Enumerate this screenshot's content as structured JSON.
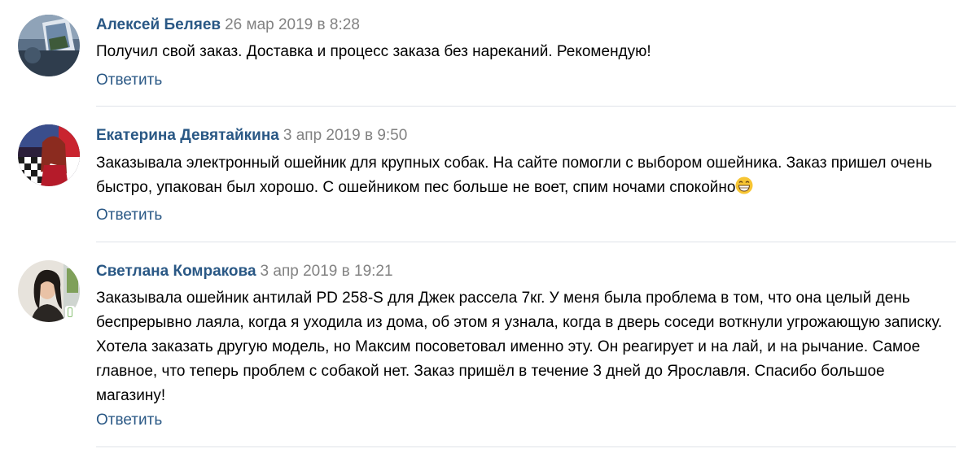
{
  "comments": [
    {
      "author": "Алексей Беляев",
      "date": "26 мар 2019 в 8:28",
      "text": "Получил свой заказ. Доставка и процесс заказа без нареканий. Рекомендую!",
      "reply_label": "Ответить",
      "avatar": "photo-avatar"
    },
    {
      "author": "Екатерина Девятайкина",
      "date": "3 апр 2019 в 9:50",
      "text": "Заказывала электронный ошейник для крупных собак. На сайте помогли с выбором ошейника. Заказ пришел очень быстро, упакован был хорошо. С ошейником пес больше не воет, спим ночами спокойно",
      "emoji": "grinning-face-emoji",
      "reply_label": "Ответить",
      "avatar": "photo-avatar"
    },
    {
      "author": "Светлана Комракова",
      "date": "3 апр 2019 в 19:21",
      "text": "Заказывала ошейник антилай PD 258-S для Джек рассела 7кг. У меня была проблема в том, что она целый день беспрерывно лаяла, когда я уходила из дома, об этом я узнала, когда в дверь соседи воткнули угрожающую записку. Хотела заказать другую модель, но Максим посоветовал именно эту. Он реагирует и на лай, и на рычание. Самое главное, что теперь проблем с собакой нет. Заказ пришёл в течение 3 дней до Ярославля. Спасибо большое магазину!",
      "reply_label": "Ответить",
      "avatar": "photo-avatar",
      "status_icon": "mobile-online-icon"
    }
  ],
  "colors": {
    "author": "#2a5885",
    "date": "#828282",
    "link": "#2a5885",
    "divider": "#dfe3e8",
    "online": "#8ac176"
  }
}
